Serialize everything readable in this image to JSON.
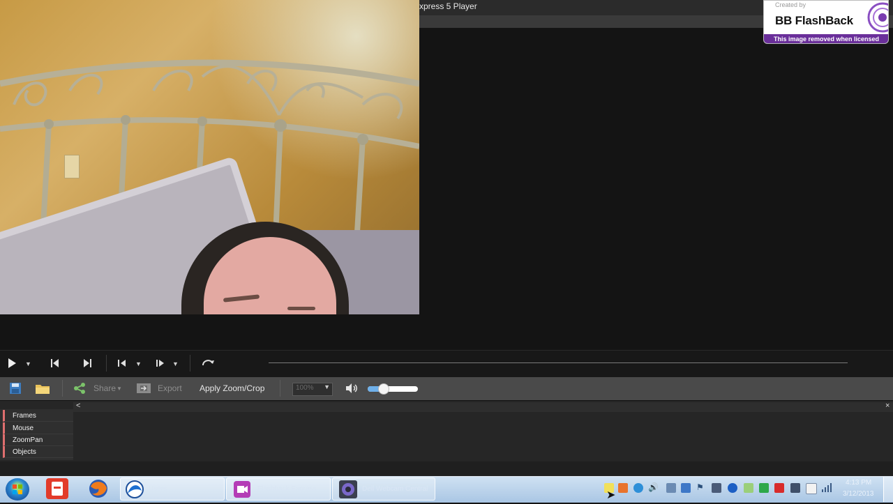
{
  "window": {
    "title": "xpress 5 Player"
  },
  "watermark": {
    "created_by": "Created by",
    "brand": "BB FlashBack",
    "notice": "This image removed when licensed"
  },
  "playback": {
    "buttons": [
      "play",
      "go-to-start",
      "go-to-end",
      "previous-frame",
      "next-frame",
      "loop"
    ]
  },
  "toolbar": {
    "share_label": "Share",
    "export_label": "Export",
    "apply_zoom_label": "Apply Zoom/Crop",
    "zoom_value": "100%",
    "volume_level": 0.3
  },
  "tracks": [
    "Frames",
    "Mouse",
    "ZoomPan",
    "Objects"
  ],
  "taskbar": {
    "items": [
      "Users",
      "Flashback Express",
      "Dell Webcam Central"
    ],
    "clock_time": "4:13 PM",
    "clock_date": "3/12/2013"
  },
  "colors": {
    "accent": "#6fb0ea",
    "track_marker": "#e06f6f",
    "watermark_purple": "#6a2f9a"
  }
}
